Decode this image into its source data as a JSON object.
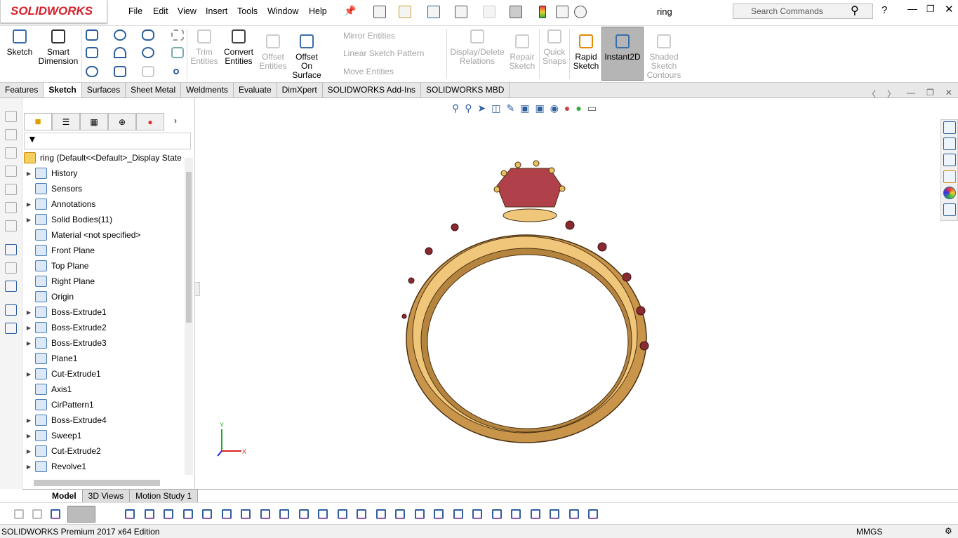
{
  "app": {
    "brand": "SOLIDWORKS",
    "doc_title": "ring"
  },
  "menu": [
    "File",
    "Edit",
    "View",
    "Insert",
    "Tools",
    "Window",
    "Help"
  ],
  "search": {
    "placeholder": "Search Commands"
  },
  "ribbon": {
    "sketch": "Sketch",
    "smart_dimension": "Smart Dimension",
    "trim_entities": "Trim Entities",
    "convert_entities": "Convert Entities",
    "offset_entities": "Offset Entities",
    "offset_on_surface": "Offset On Surface",
    "mirror_entities": "Mirror Entities",
    "linear_sketch_pattern": "Linear Sketch Pattern",
    "move_entities": "Move Entities",
    "display_delete_relations": "Display/Delete Relations",
    "repair_sketch": "Repair Sketch",
    "quick_snaps": "Quick Snaps",
    "rapid_sketch": "Rapid Sketch",
    "instant2d": "Instant2D",
    "shaded_sketch_contours": "Shaded Sketch Contours"
  },
  "tabs": [
    {
      "label": "Features"
    },
    {
      "label": "Sketch",
      "active": true
    },
    {
      "label": "Surfaces"
    },
    {
      "label": "Sheet Metal"
    },
    {
      "label": "Weldments"
    },
    {
      "label": "Evaluate"
    },
    {
      "label": "DimXpert"
    },
    {
      "label": "SOLIDWORKS Add-Ins"
    },
    {
      "label": "SOLIDWORKS MBD"
    }
  ],
  "tree": {
    "root": "ring  (Default<<Default>_Display State",
    "items": [
      {
        "label": "History",
        "expand": true
      },
      {
        "label": "Sensors",
        "expand": false
      },
      {
        "label": "Annotations",
        "expand": true
      },
      {
        "label": "Solid Bodies(11)",
        "expand": true
      },
      {
        "label": "Material <not specified>",
        "expand": false
      },
      {
        "label": "Front Plane",
        "expand": false
      },
      {
        "label": "Top Plane",
        "expand": false
      },
      {
        "label": "Right Plane",
        "expand": false
      },
      {
        "label": "Origin",
        "expand": false
      },
      {
        "label": "Boss-Extrude1",
        "expand": true
      },
      {
        "label": "Boss-Extrude2",
        "expand": true
      },
      {
        "label": "Boss-Extrude3",
        "expand": true
      },
      {
        "label": "Plane1",
        "expand": false
      },
      {
        "label": "Cut-Extrude1",
        "expand": true
      },
      {
        "label": "Axis1",
        "expand": false
      },
      {
        "label": "CirPattern1",
        "expand": false
      },
      {
        "label": "Boss-Extrude4",
        "expand": true
      },
      {
        "label": "Sweep1",
        "expand": true
      },
      {
        "label": "Cut-Extrude2",
        "expand": true
      },
      {
        "label": "Revolve1",
        "expand": true
      }
    ]
  },
  "triad": {
    "x": "X",
    "y": "Y"
  },
  "bottom_tabs": [
    {
      "label": "Model",
      "active": true
    },
    {
      "label": "3D Views"
    },
    {
      "label": "Motion Study 1"
    }
  ],
  "status": {
    "edition": "SOLIDWORKS Premium 2017 x64 Edition",
    "units": "MMGS"
  },
  "colors": {
    "accent": "#d5202a",
    "ring_gold": "#e8b866",
    "gem": "#b0404a"
  }
}
